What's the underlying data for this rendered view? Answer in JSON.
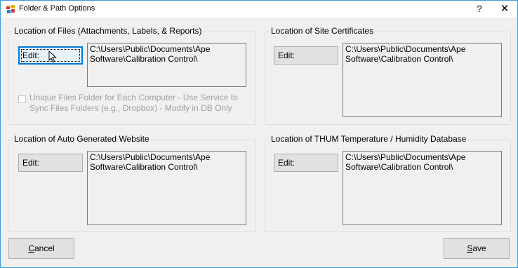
{
  "window": {
    "title": "Folder & Path Options",
    "help_label": "?",
    "close_label": "✕"
  },
  "files_group": {
    "label": "Location of Files (Attachments, Labels, & Reports)",
    "edit_label": "Edit:",
    "path": "C:\\Users\\Public\\Documents\\Ape Software\\Calibration Control\\",
    "checkbox_label": "Unique Files Folder for Each Computer - Use Service to Sync Files Folders (e.g., Dropbox) - Modify in DB Only",
    "checkbox_checked": false
  },
  "certificates_group": {
    "label": "Location of Site Certificates",
    "edit_label": "Edit:",
    "path": "C:\\Users\\Public\\Documents\\Ape Software\\Calibration Control\\"
  },
  "website_group": {
    "label": "Location of Auto Generated Website",
    "edit_label": "Edit:",
    "path": "C:\\Users\\Public\\Documents\\Ape Software\\Calibration Control\\"
  },
  "thum_group": {
    "label": "Location of THUM Temperature / Humidity Database",
    "edit_label": "Edit:",
    "path": "C:\\Users\\Public\\Documents\\Ape Software\\Calibration Control\\"
  },
  "buttons": {
    "cancel_accel": "C",
    "cancel_rest": "ancel",
    "save_accel": "S",
    "save_rest": "ave"
  },
  "icons": {
    "app": "folder-options-icon",
    "cursor": "mouse-pointer-icon"
  }
}
